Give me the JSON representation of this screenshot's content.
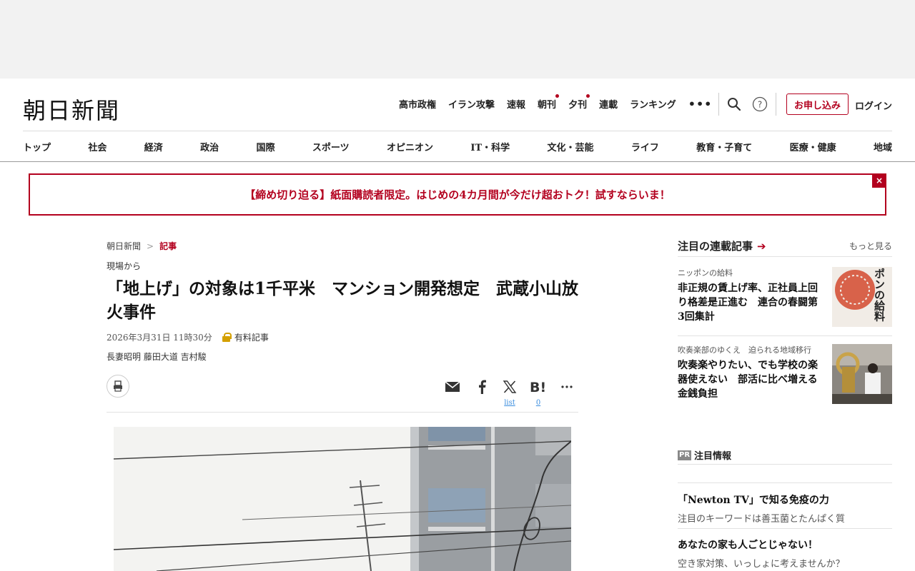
{
  "header": {
    "logo": "朝日新聞",
    "nav": [
      "高市政権",
      "イラン攻撃",
      "速報",
      "朝刊",
      "夕刊",
      "連載",
      "ランキング"
    ],
    "subscribe_label": "お申し込み",
    "login_label": "ログイン"
  },
  "categories": [
    "トップ",
    "社会",
    "経済",
    "政治",
    "国際",
    "スポーツ",
    "オピニオン",
    "IT・科学",
    "文化・芸能",
    "ライフ",
    "教育・子育て",
    "医療・健康",
    "地域"
  ],
  "banner": {
    "text": "【締め切り迫る】紙面購読者限定。はじめの4カ月間が今だけ超おトク！試すならいま！",
    "close": "×"
  },
  "article": {
    "breadcrumb": [
      "朝日新聞",
      "記事"
    ],
    "breadcrumb_sep": ">",
    "series": "現場から",
    "headline": "「地上げ」の対象は1千平米　マンション開発想定　武蔵小山放火事件",
    "date": "2026年3月31日 11時30分",
    "premium_label": "有料記事",
    "authors": "長妻昭明 藤田大道 吉村駿",
    "share_counts": {
      "x": "list",
      "hatena": "0"
    }
  },
  "sidebar": {
    "title": "注目の連載記事",
    "more_label": "もっと見る",
    "items": [
      {
        "kicker": "ニッポンの給料",
        "title": "非正規の賃上げ率、正社員上回り格差是正進む　連合の春闘第3回集計",
        "thumb_text": "ニッポンの給料"
      },
      {
        "kicker": "吹奏楽部のゆくえ　迫られる地域移行",
        "title": "吹奏楽やりたい、でも学校の楽器使えない　部活に比べ増える金銭負担"
      }
    ],
    "pr_badge": "PR",
    "pr_title": "注目情報",
    "pr_items": [
      {
        "title": "「Newton TV」で知る免疫の力",
        "sub": "注目のキーワードは善玉菌とたんぱく質"
      },
      {
        "title": "あなたの家も人ごとじゃない！",
        "sub": "空き家対策、いっしょに考えませんか？"
      }
    ]
  },
  "colors": {
    "accent": "#b3001e",
    "link": "#3a8dde",
    "premium": "#d4a000"
  }
}
